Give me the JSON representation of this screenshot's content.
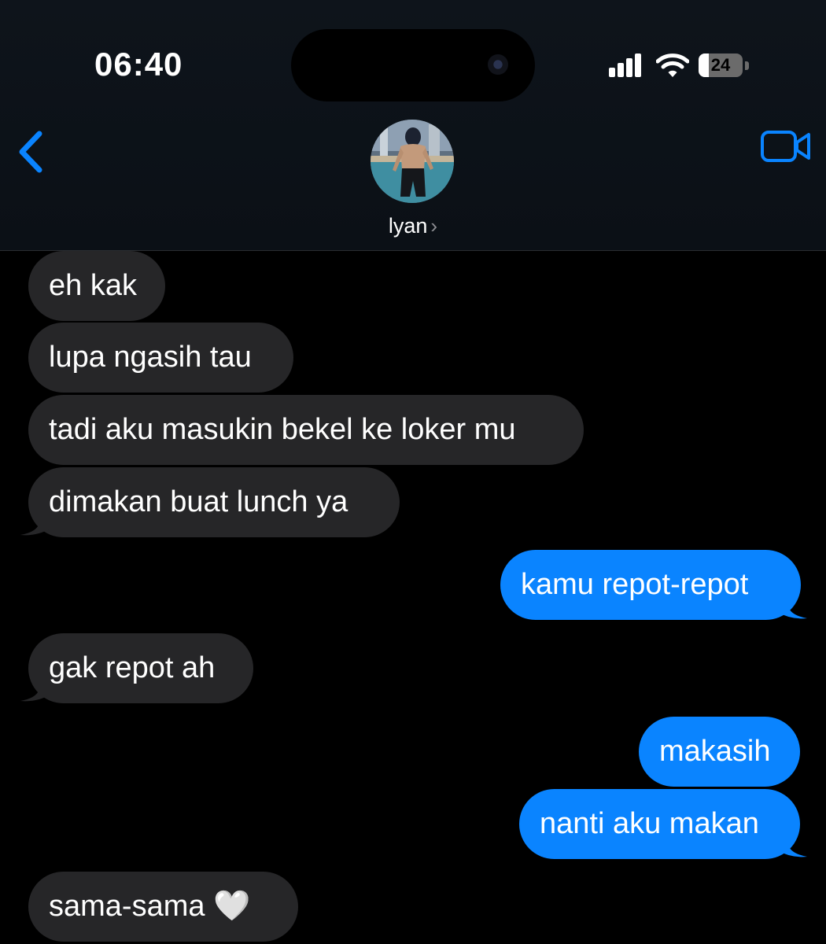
{
  "status_bar": {
    "time": "06:40",
    "battery_level": "24",
    "battery_fraction": 0.24
  },
  "header": {
    "contact_name": "lyan",
    "chevron": "›",
    "back_icon": "chevron-left-icon",
    "video_icon": "video-camera-icon"
  },
  "colors": {
    "incoming_bubble": "#262628",
    "outgoing_bubble": "#0a84ff",
    "accent": "#0a84ff",
    "background": "#000000"
  },
  "messages": [
    {
      "direction": "incoming",
      "text": "eh kak"
    },
    {
      "direction": "incoming",
      "text": "lupa ngasih tau"
    },
    {
      "direction": "incoming",
      "text": "tadi aku masukin bekel ke loker mu"
    },
    {
      "direction": "incoming",
      "text": "dimakan buat lunch ya"
    },
    {
      "direction": "outgoing",
      "text": "kamu repot-repot"
    },
    {
      "direction": "incoming",
      "text": "gak repot ah"
    },
    {
      "direction": "outgoing",
      "text": "makasih"
    },
    {
      "direction": "outgoing",
      "text": "nanti aku makan"
    },
    {
      "direction": "incoming",
      "text": "sama-sama 🤍"
    }
  ]
}
